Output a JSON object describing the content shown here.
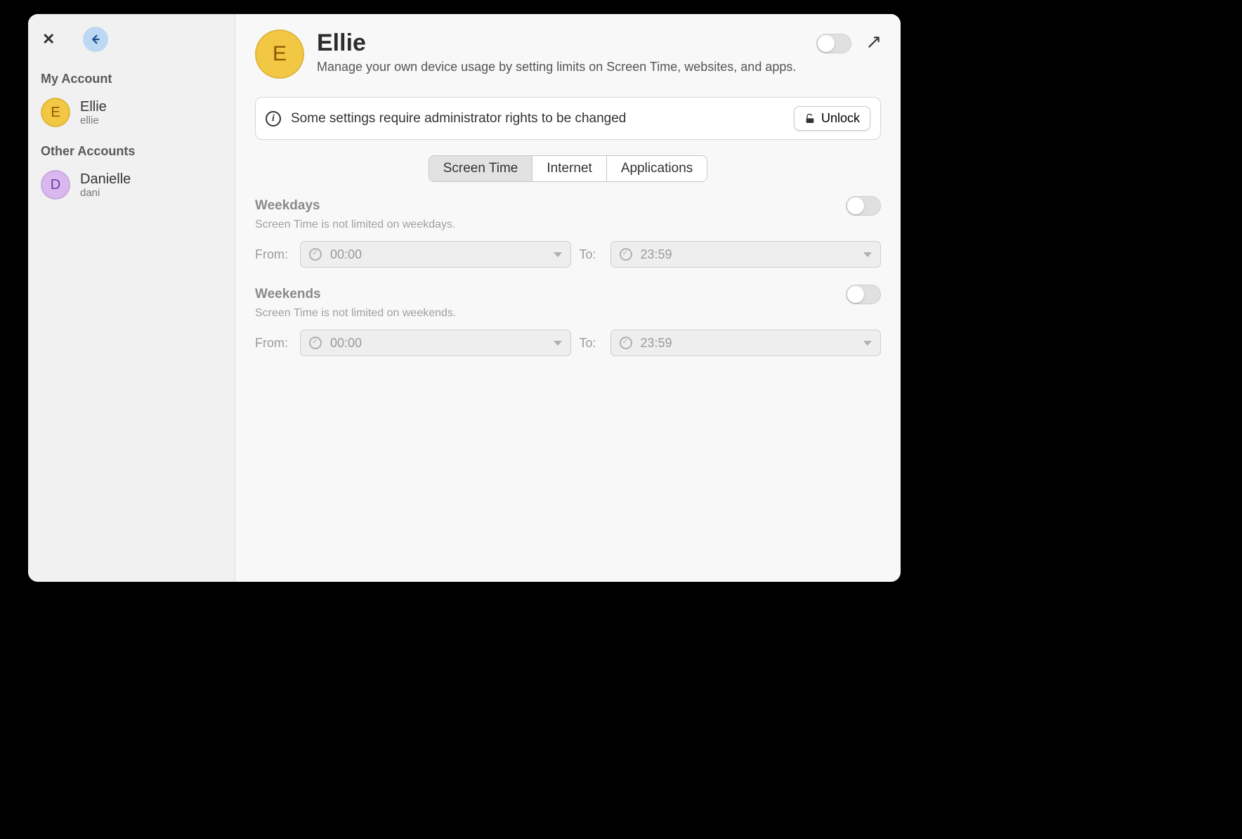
{
  "sidebar": {
    "my_account_label": "My Account",
    "other_accounts_label": "Other Accounts",
    "accounts": {
      "mine": {
        "initial": "E",
        "name": "Ellie",
        "username": "ellie"
      },
      "other": {
        "initial": "D",
        "name": "Danielle",
        "username": "dani"
      }
    }
  },
  "header": {
    "avatar_initial": "E",
    "title": "Ellie",
    "subtitle": "Manage your own device usage by setting limits on Screen Time, websites, and apps."
  },
  "banner": {
    "text": "Some settings require administrator rights to be changed",
    "unlock_label": "Unlock"
  },
  "tabs": {
    "screen_time": "Screen Time",
    "internet": "Internet",
    "applications": "Applications"
  },
  "weekdays": {
    "title": "Weekdays",
    "subtitle": "Screen Time is not limited on weekdays.",
    "from_label": "From:",
    "to_label": "To:",
    "from_value": "00:00",
    "to_value": "23:59"
  },
  "weekends": {
    "title": "Weekends",
    "subtitle": "Screen Time is not limited on weekends.",
    "from_label": "From:",
    "to_label": "To:",
    "from_value": "00:00",
    "to_value": "23:59"
  }
}
